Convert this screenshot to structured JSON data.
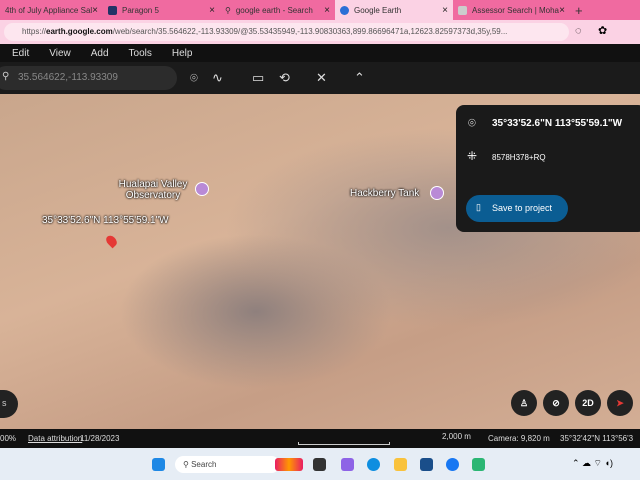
{
  "browser": {
    "tabs": [
      {
        "title": "4th of July Appliance Sal"
      },
      {
        "title": "Paragon 5"
      },
      {
        "title": "google earth - Search"
      },
      {
        "title": "Google Earth",
        "active": true
      },
      {
        "title": "Assessor Search | Moha"
      }
    ],
    "url_prefix": "https://",
    "url_domain": "earth.google.com",
    "url_rest": "/web/search/35.564622,-113.93309/@35.53435949,-113.90830363,899.86696471a,12623.82597373d,35y,59..."
  },
  "menu": [
    "Edit",
    "View",
    "Add",
    "Tools",
    "Help"
  ],
  "search": {
    "value": "35.564622,-113.93309"
  },
  "map": {
    "labels": {
      "observatory": "Hualapai Valley Observatory",
      "tank": "Hackberry Tank",
      "pin": "35°33'52.6\"N 113°55'59.1\"W"
    },
    "buttons": {
      "left": "s",
      "view2d": "2D"
    }
  },
  "panel": {
    "coords": "35°33'52.6\"N 113°55'59.1\"W",
    "plus_code": "8578H378+RQ",
    "save": "Save to project"
  },
  "status": {
    "zoom": "00%",
    "attribution": "Data attribution",
    "date": "11/28/2023",
    "scale": "2,000 m",
    "camera": "Camera: 9,820 m",
    "coords": "35°32'42\"N 113°56'3"
  },
  "taskbar": {
    "search": "Search"
  },
  "colors": {
    "tab_bar": "#f06aa0",
    "accent": "#0b5d93",
    "pin": "#e53935"
  }
}
